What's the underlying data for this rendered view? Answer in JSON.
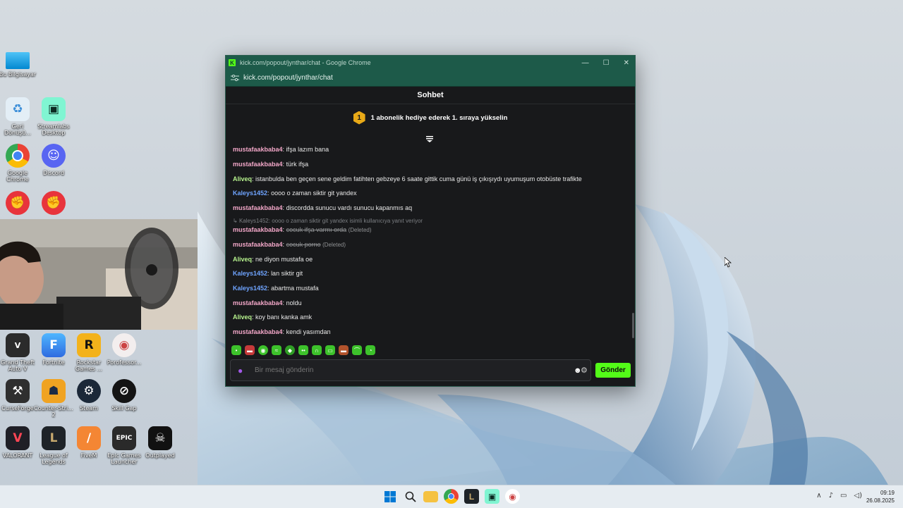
{
  "desktop": {
    "icons": [
      {
        "label": "Bu Bilgisayar",
        "icon": "monitor-icon"
      },
      {
        "label": "Geri Dönüşü...",
        "icon": "recycle-bin-icon"
      },
      {
        "label": "Streamlabs Desktop",
        "icon": "streamlabs-icon"
      },
      {
        "label": "Google Chrome",
        "icon": "chrome-icon"
      },
      {
        "label": "Discord",
        "icon": "discord-icon"
      },
      {
        "label": "Grand Theft Auto V",
        "icon": "gta-icon"
      },
      {
        "label": "Fortnite",
        "icon": "fortnite-icon"
      },
      {
        "label": "Rockstar Games ...",
        "icon": "rockstar-icon"
      },
      {
        "label": "Porofessor...",
        "icon": "porofessor-icon"
      },
      {
        "label": "CurseForge",
        "icon": "curseforge-icon"
      },
      {
        "label": "Counter-Stri... 2",
        "icon": "counter-strike-icon"
      },
      {
        "label": "Steam",
        "icon": "steam-icon"
      },
      {
        "label": "Skill Gap",
        "icon": "skill-gap-icon"
      },
      {
        "label": "VALORANT",
        "icon": "valorant-icon"
      },
      {
        "label": "League of Legends",
        "icon": "league-icon"
      },
      {
        "label": "FiveM",
        "icon": "fivem-icon"
      },
      {
        "label": "Epic Games Launcher",
        "icon": "epic-games-icon"
      },
      {
        "label": "Outplayed",
        "icon": "outplayed-icon"
      }
    ]
  },
  "window": {
    "title": "kick.com/popout/jynthar/chat - Google Chrome",
    "url": "kick.com/popout/jynthar/chat",
    "controls": {
      "minimize": "—",
      "maximize": "☐",
      "close": "✕"
    }
  },
  "chat": {
    "header": "Sohbet",
    "promo_badge": "1",
    "promo_text": "1 abonelik hediye ederek 1. sıraya yükselin",
    "messages": [
      {
        "user": "mustafaakbaba4",
        "text": "ifşa lazım bana",
        "color": "#f2a7c8"
      },
      {
        "user": "mustafaakbaba4",
        "text": "türk ifşa",
        "color": "#f2a7c8"
      },
      {
        "user": "Aliveq",
        "text": "istanbulda ben geçen sene geldim fatihten gebzeye 6 saate gittik cuma günü iş çıkışıydı uyumuşum otobüste trafikte",
        "color": "#b6f28d"
      },
      {
        "user": "Kaleys1452",
        "text": "oooo o zaman siktir git yandex",
        "color": "#6fa4ff"
      },
      {
        "user": "mustafaakbaba4",
        "text": "discordda sunucu vardı sunucu kapanmıs aq",
        "color": "#f2a7c8"
      },
      {
        "user": "mustafaakbaba4",
        "text": "cocuk ifşa varmı orda",
        "color": "#f2a7c8",
        "deleted": true
      },
      {
        "user": "mustafaakbaba4",
        "text": "cocuk porno",
        "color": "#f2a7c8",
        "deleted": true
      },
      {
        "user": "Aliveq",
        "text": "ne diyon mustafa oe",
        "color": "#b6f28d"
      },
      {
        "user": "Kaleys1452",
        "text": "lan siktir git",
        "color": "#6fa4ff"
      },
      {
        "user": "Kaleys1452",
        "text": "abartma mustafa",
        "color": "#6fa4ff"
      },
      {
        "user": "mustafaakbaba4",
        "text": "noldu",
        "color": "#f2a7c8"
      },
      {
        "user": "Aliveq",
        "text": "koy banı kanka amk",
        "color": "#b6f28d"
      },
      {
        "user": "mustafaakbaba4",
        "text": "kendi yasımdan",
        "color": "#f2a7c8"
      }
    ],
    "reply_context": "Kaleys1452: oooo o zaman siktir git yandex isimli kullanıcıya yanıt veriyor",
    "deleted_tag": "(Deleted)",
    "input_placeholder": "Bir mesaj gönderin",
    "send_label": "Gönder",
    "accent": "#53fc18"
  },
  "taskbar": {
    "apps": [
      "windows-start-icon",
      "search-icon",
      "file-explorer-icon",
      "chrome-icon",
      "league-icon",
      "streamlabs-icon",
      "porofessor-icon"
    ],
    "time": "09:19",
    "date": "26.08.2025"
  }
}
